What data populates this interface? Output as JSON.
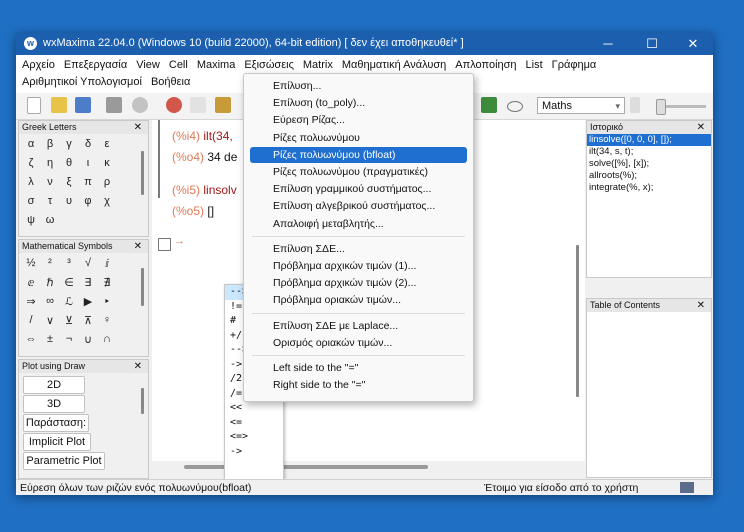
{
  "window": {
    "title": "wxMaxima 22.04.0 (Windows 10 (build 22000), 64-bit edition) [ δεν έχει αποθηκευθεί* ]",
    "minimize": "─",
    "maximize": "☐",
    "close": "✕"
  },
  "menubar": {
    "row1": [
      "Αρχείο",
      "Επεξεργασία",
      "View",
      "Cell",
      "Maxima",
      "Εξισώσεις",
      "Matrix",
      "Μαθηματική Ανάλυση",
      "Απλοποίηση",
      "List",
      "Γράφημα"
    ],
    "row2": [
      "Αριθμητικοί Υπολογισμοί",
      "Βοήθεια"
    ]
  },
  "toolbar": {
    "math_mode": "Maths"
  },
  "greek_pane": {
    "title": "Greek Letters",
    "close": "✕",
    "rows": [
      [
        "α",
        "β",
        "γ",
        "δ",
        "ε"
      ],
      [
        "ζ",
        "η",
        "θ",
        "ι",
        "κ"
      ],
      [
        "λ",
        "ν",
        "ξ",
        "π",
        "ρ"
      ],
      [
        "σ",
        "τ",
        "υ",
        "φ",
        "χ"
      ],
      [
        "ψ",
        "ω"
      ]
    ]
  },
  "symbols_pane": {
    "title": "Mathematical Symbols",
    "close": "✕",
    "rows": [
      [
        "½",
        "²",
        "³",
        "√",
        "ⅈ"
      ],
      [
        "ⅇ",
        "ℏ",
        "∈",
        "∃",
        "∄"
      ],
      [
        "⇒",
        "∞",
        "ℒ",
        "▶",
        "‣"
      ],
      [
        "/",
        "∨",
        "⊻",
        "⊼",
        "♀"
      ],
      [
        "⇔",
        "±",
        "¬",
        "∪",
        "∩"
      ]
    ]
  },
  "plot_pane": {
    "title": "Plot using Draw",
    "close": "✕",
    "buttons": [
      "2D",
      "3D",
      "Παράσταση:",
      "Implicit Plot",
      "Parametric Plot"
    ]
  },
  "worksheet": {
    "l1_label": "(%i4)",
    "l1_text": "ilt(34,",
    "l2_label": "(%o4)",
    "l2_text": "34 de",
    "l3_label": "(%i5)",
    "l3_text": "linsolv",
    "l4_label": "(%o5)",
    "l4_text": "[]",
    "cursor_arrow": "→"
  },
  "autocomplete": {
    "items": [
      "-->",
      "!=",
      "#",
      "+/-",
      "-->",
      "->",
      "/2",
      "/=",
      "<<",
      "<=",
      "<=>",
      "->"
    ]
  },
  "equations_menu": {
    "items": [
      "Επίλυση...",
      "Επίλυση (to_poly)...",
      "Εύρεση Ρίζας...",
      "Ρίζες πολυωνύμου",
      "Ρίζες πολυωνύμου (bfloat)",
      "Ρίζες πολυωνύμου (πραγματικές)",
      "Επίλυση γραμμικού συστήματος...",
      "Επίλυση αλγεβρικού συστήματος...",
      "Απαλοιφή μεταβλητής...",
      "Επίλυση ΣΔΕ...",
      "Πρόβλημα αρχικών τιμών (1)...",
      "Πρόβλημα αρχικών τιμών (2)...",
      "Πρόβλημα οριακών τιμών...",
      "Επίλυση ΣΔΕ με Laplace...",
      "Ορισμός οριακών τιμών...",
      "Left side to the \"=\"",
      "Right side to the \"=\""
    ],
    "highlighted_index": 4
  },
  "history_pane": {
    "title": "Ιστορικό",
    "close": "✕",
    "items": [
      "linsolve([0, 0, 0], []);",
      "ilt(34, s, t);",
      "solve([%], [x]);",
      "allroots(%);",
      "integrate(%, x);"
    ]
  },
  "toc_pane": {
    "title": "Table of Contents",
    "close": "✕"
  },
  "statusbar": {
    "left": "Εύρεση όλων των ριζών ενός πολυωνύμου(bfloat)",
    "right": "Έτοιμο για είσοδο από το χρήστη"
  },
  "colors": {
    "titlebar": "#1b5fae",
    "highlight": "#1e6fd0",
    "label": "#e07a56",
    "input": "#a01818"
  }
}
